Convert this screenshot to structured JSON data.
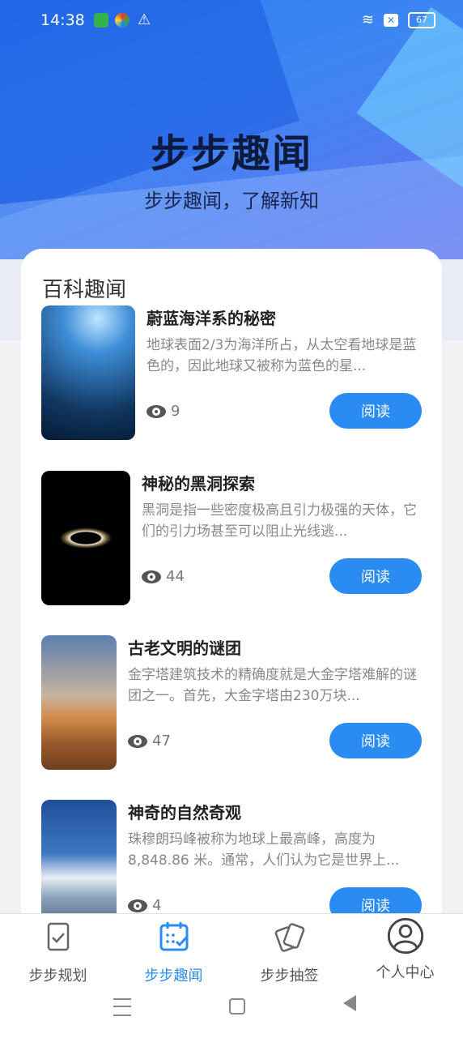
{
  "status_bar": {
    "time": "14:38",
    "battery": "67"
  },
  "header": {
    "title": "步步趣闻",
    "subtitle": "步步趣闻，了解新知"
  },
  "section": {
    "title": "百科趣闻"
  },
  "articles": [
    {
      "title": "蔚蓝海洋系的秘密",
      "desc": "地球表面2/3为海洋所占，从太空看地球是蓝色的，因此地球又被称为蓝色的星...",
      "views": "9",
      "read_label": "阅读",
      "image": "ocean-image"
    },
    {
      "title": "神秘的黑洞探索",
      "desc": "黑洞是指一些密度极高且引力极强的天体，它们的引力场甚至可以阻止光线逃...",
      "views": "44",
      "read_label": "阅读",
      "image": "black-hole-image"
    },
    {
      "title": "古老文明的谜团",
      "desc": "金字塔建筑技术的精确度就是大金字塔难解的谜团之一。首先，大金字塔由230万块...",
      "views": "47",
      "read_label": "阅读",
      "image": "pyramid-image"
    },
    {
      "title": "神奇的自然奇观",
      "desc": "珠穆朗玛峰被称为地球上最高峰，高度为8,848.86 米。通常，人们认为它是世界上...",
      "views": "4",
      "read_label": "阅读",
      "image": "mountain-image"
    }
  ],
  "nav": [
    {
      "label": "步步规划",
      "icon": "checklist-icon",
      "active": false
    },
    {
      "label": "步步趣闻",
      "icon": "calendar-check-icon",
      "active": true
    },
    {
      "label": "步步抽签",
      "icon": "cards-icon",
      "active": false
    },
    {
      "label": "个人中心",
      "icon": "user-icon",
      "active": false
    }
  ],
  "colors": {
    "accent": "#2a8bf2",
    "title": "#0d1b3f"
  }
}
